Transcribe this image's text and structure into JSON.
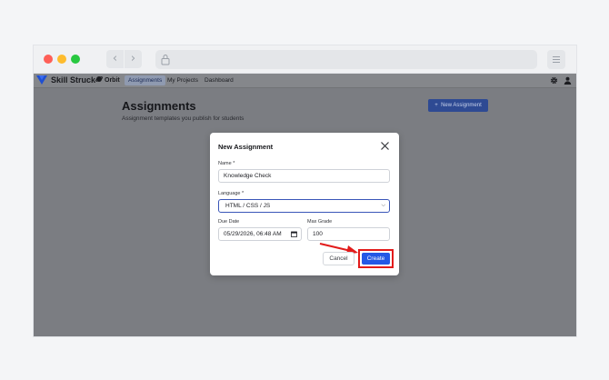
{
  "app": {
    "brand": "Skill Struck",
    "product": "Orbit",
    "tabs": [
      {
        "label": "Assignments",
        "active": true
      },
      {
        "label": "My Projects",
        "active": false
      },
      {
        "label": "Dashboard",
        "active": false
      }
    ]
  },
  "page": {
    "title": "Assignments",
    "subtitle": "Assignment templates you publish for students",
    "new_button_label": "New Assignment"
  },
  "modal": {
    "title": "New Assignment",
    "name_label": "Name *",
    "name_value": "Knowledge Check",
    "language_label": "Language *",
    "language_value": "HTML / CSS / JS",
    "due_date_label": "Due Date",
    "due_date_value": "05/29/2026, 06:48 AM",
    "max_grade_label": "Max Grade",
    "max_grade_value": "100",
    "cancel_label": "Cancel",
    "create_label": "Create"
  },
  "colors": {
    "brand_blue": "#2458e6",
    "highlight_red": "#e21b1b",
    "overlay": "#7b7d82"
  }
}
